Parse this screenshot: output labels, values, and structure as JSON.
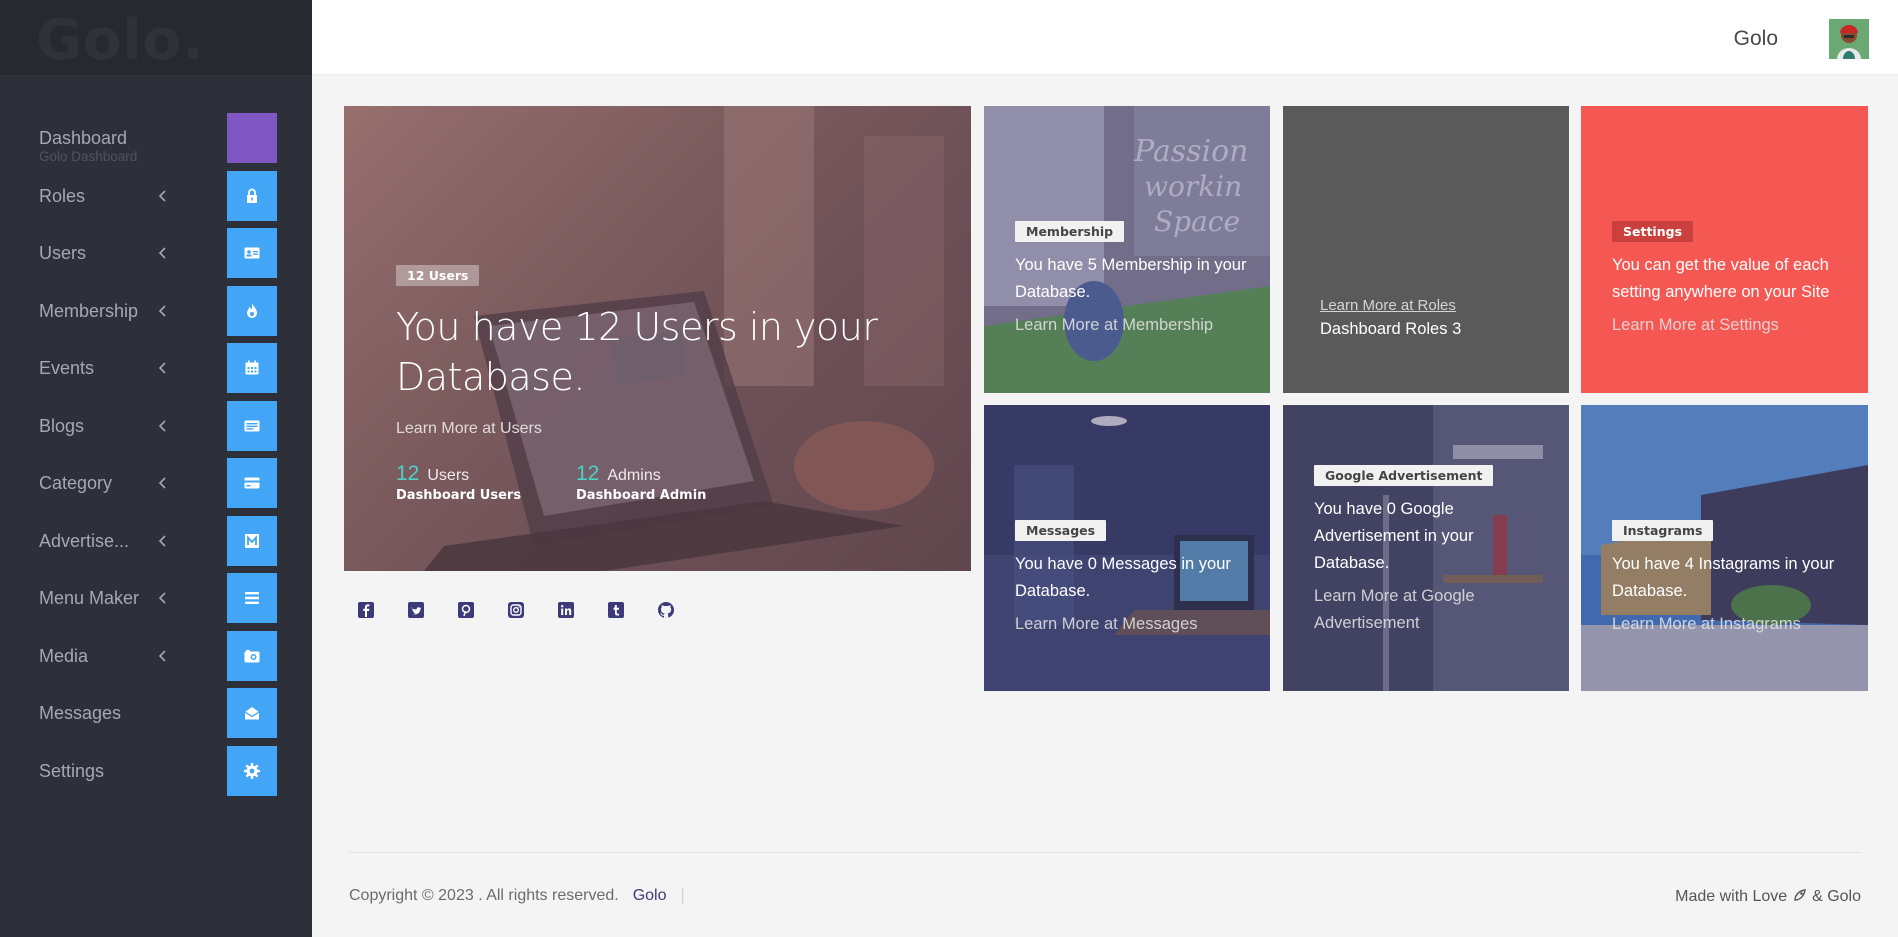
{
  "sidebar": {
    "logo": "Golo.",
    "items": [
      {
        "label": "Dashboard",
        "sublabel": "Golo Dashboard",
        "icon": "dashboard-icon",
        "has_chevron": false
      },
      {
        "label": "Roles",
        "icon": "lock-icon",
        "has_chevron": true
      },
      {
        "label": "Users",
        "icon": "id-card-icon",
        "has_chevron": true
      },
      {
        "label": "Membership",
        "icon": "fire-icon",
        "has_chevron": true
      },
      {
        "label": "Events",
        "icon": "calendar-icon",
        "has_chevron": true
      },
      {
        "label": "Blogs",
        "icon": "newspaper-icon",
        "has_chevron": true
      },
      {
        "label": "Category",
        "icon": "credit-card-icon",
        "has_chevron": true
      },
      {
        "label": "Advertise...",
        "icon": "gmail-icon",
        "has_chevron": true
      },
      {
        "label": "Menu Maker",
        "icon": "list-icon",
        "has_chevron": true
      },
      {
        "label": "Media",
        "icon": "camera-icon",
        "has_chevron": true
      },
      {
        "label": "Messages",
        "icon": "envelope-open-icon",
        "has_chevron": false
      },
      {
        "label": "Settings",
        "icon": "gear-icon",
        "has_chevron": false
      }
    ]
  },
  "header": {
    "username": "Golo"
  },
  "hero": {
    "tag": "12 Users",
    "title": "You have 12 Users in your Database.",
    "link": "Learn More at Users",
    "stats": [
      {
        "value": "12",
        "unit": "Users",
        "desc": "Dashboard Users"
      },
      {
        "value": "12",
        "unit": "Admins",
        "desc": "Dashboard Admin"
      }
    ]
  },
  "cards": {
    "membership": {
      "tag": "Membership",
      "text": "You have 5 Membership in your Database.",
      "link": "Learn More at Membership"
    },
    "roles": {
      "link": "Learn More at Roles",
      "text": "Dashboard Roles 3"
    },
    "settings": {
      "tag": "Settings",
      "text": "You can get the value of each setting anywhere on your Site",
      "link": "Learn More at Settings"
    },
    "messages": {
      "tag": "Messages",
      "text": "You have 0 Messages in your Database.",
      "link": "Learn More at Messages"
    },
    "google": {
      "tag": "Google Advertisement",
      "text": "You have 0 Google Advertisement in your Database.",
      "link": "Learn More at Google Advertisement"
    },
    "instagrams": {
      "tag": "Instagrams",
      "text": "You have 4 Instagrams in your Database.",
      "link": "Learn More at Instagrams"
    }
  },
  "social": [
    "facebook-icon",
    "twitter-icon",
    "pinterest-icon",
    "instagram-icon",
    "linkedin-icon",
    "tumblr-icon",
    "github-icon"
  ],
  "footer": {
    "copyright": "Copyright © 2023 . All rights reserved.",
    "brand": "Golo",
    "separator": "|",
    "made_with_prefix": "Made with Love",
    "made_with_suffix": "& Golo"
  },
  "colors": {
    "sidebar_bg": "#2d3038",
    "icon_blue": "#42a5f5",
    "icon_purple": "#7e57c2",
    "settings_red": "#f55753",
    "roles_gray": "#5a5a5a",
    "accent_teal": "#4dd0c7"
  }
}
